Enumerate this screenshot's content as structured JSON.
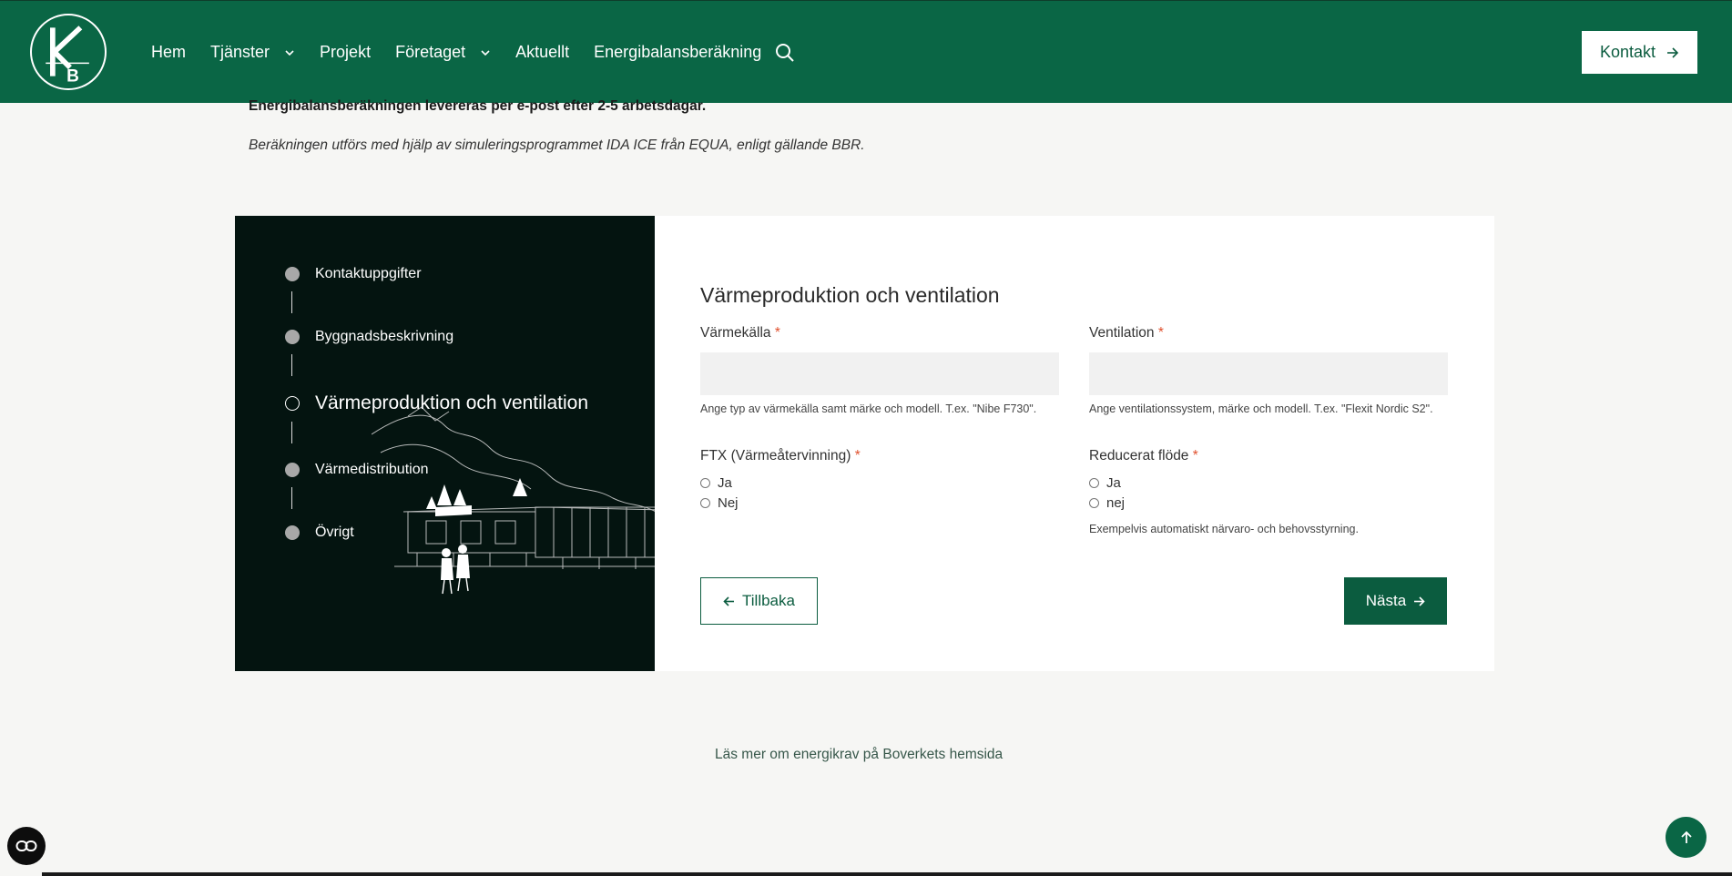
{
  "header": {
    "logo_letters": "KB",
    "nav": [
      {
        "label": "Hem",
        "has_dropdown": false
      },
      {
        "label": "Tjänster",
        "has_dropdown": true
      },
      {
        "label": "Projekt",
        "has_dropdown": false
      },
      {
        "label": "Företaget",
        "has_dropdown": true
      },
      {
        "label": "Aktuellt",
        "has_dropdown": false
      },
      {
        "label": "Energibalansberäkning",
        "has_dropdown": false
      }
    ],
    "contact_label": "Kontakt"
  },
  "intro": {
    "bold_text": "Energibalansberäkningen levereras per e-post efter 2-5 arbetsdagar.",
    "italic_text": "Beräkningen utförs med hjälp av simuleringsprogrammet IDA ICE från EQUA, enligt gällande BBR."
  },
  "steps": [
    {
      "label": "Kontaktuppgifter",
      "active": false
    },
    {
      "label": "Byggnadsbeskrivning",
      "active": false
    },
    {
      "label": "Värmeproduktion och ventilation",
      "active": true
    },
    {
      "label": "Värmedistribution",
      "active": false
    },
    {
      "label": "Övrigt",
      "active": false
    }
  ],
  "form": {
    "title": "Värmeproduktion och ventilation",
    "required_mark": "*",
    "heat_source": {
      "label": "Värmekälla",
      "value": "",
      "help": "Ange typ av värmekälla samt märke och modell. T.ex. \"Nibe F730\"."
    },
    "ventilation": {
      "label": "Ventilation",
      "value": "",
      "help": "Ange ventilationssystem, märke och modell. T.ex. \"Flexit Nordic S2\"."
    },
    "ftx": {
      "label": "FTX (Värmeåtervinning)",
      "options": [
        "Ja",
        "Nej"
      ]
    },
    "reduced_flow": {
      "label": "Reducerat flöde",
      "options": [
        "Ja",
        "nej"
      ],
      "help": "Exempelvis automatiskt närvaro- och behovsstyrning."
    },
    "back_label": "Tillbaka",
    "next_label": "Nästa"
  },
  "footer": {
    "link_text": "Läs mer om energikrav på Boverkets hemsida"
  },
  "colors": {
    "brand_green": "#0a6645",
    "panel_dark": "#041410",
    "required_red": "#e0502d"
  }
}
